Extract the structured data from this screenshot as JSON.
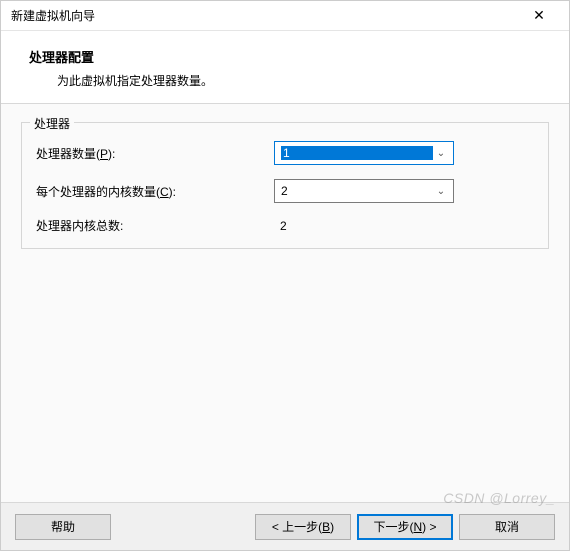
{
  "window": {
    "title": "新建虚拟机向导"
  },
  "header": {
    "title": "处理器配置",
    "description": "为此虚拟机指定处理器数量。"
  },
  "group": {
    "legend": "处理器",
    "processor_count_label_pre": "处理器数量(",
    "processor_count_hotkey": "P",
    "processor_count_label_post": "):",
    "processor_count_value": "1",
    "cores_label_pre": "每个处理器的内核数量(",
    "cores_hotkey": "C",
    "cores_label_post": "):",
    "cores_value": "2",
    "total_label": "处理器内核总数:",
    "total_value": "2"
  },
  "buttons": {
    "help": "帮助",
    "back_pre": "< 上一步(",
    "back_hotkey": "B",
    "back_post": ")",
    "next_pre": "下一步(",
    "next_hotkey": "N",
    "next_post": ") >",
    "cancel": "取消"
  },
  "watermark": "CSDN @Lorrey_"
}
